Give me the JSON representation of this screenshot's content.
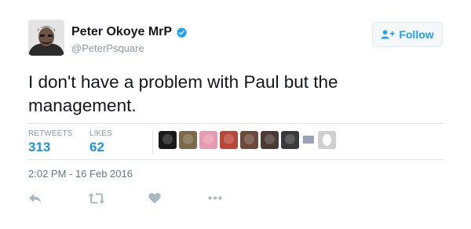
{
  "tweet": {
    "author_name": "Peter Okoye MrP",
    "author_handle": "@PeterPsquare",
    "follow_label": "Follow",
    "text": "I don't have a problem with Paul but the management.",
    "timestamp": "2:02 PM - 16 Feb 2016"
  },
  "stats": {
    "retweets_label": "RETWEETS",
    "retweets_value": "313",
    "likes_label": "LIKES",
    "likes_value": "62"
  },
  "likers": [
    {
      "name": "liker-avatar-1",
      "color": "#1a1a1a"
    },
    {
      "name": "liker-avatar-2",
      "color": "#7a6a4a"
    },
    {
      "name": "liker-avatar-3",
      "color": "#e89ab0"
    },
    {
      "name": "liker-avatar-4",
      "color": "#b8473a"
    },
    {
      "name": "liker-avatar-5",
      "color": "#6b4a3a"
    },
    {
      "name": "liker-avatar-6",
      "color": "#4a3a32"
    },
    {
      "name": "liker-avatar-7",
      "color": "#3a3a3a"
    },
    {
      "name": "liker-avatar-8",
      "color": "#9aa0b8"
    },
    {
      "name": "liker-avatar-9",
      "color": "#8a8a8a"
    }
  ],
  "colors": {
    "accent": "#1da1f2",
    "verified": "#1da1f2",
    "stat_value": "#1b95e0",
    "muted": "#8899a6"
  },
  "actions": [
    "reply-icon",
    "retweet-icon",
    "like-icon",
    "more-icon"
  ]
}
